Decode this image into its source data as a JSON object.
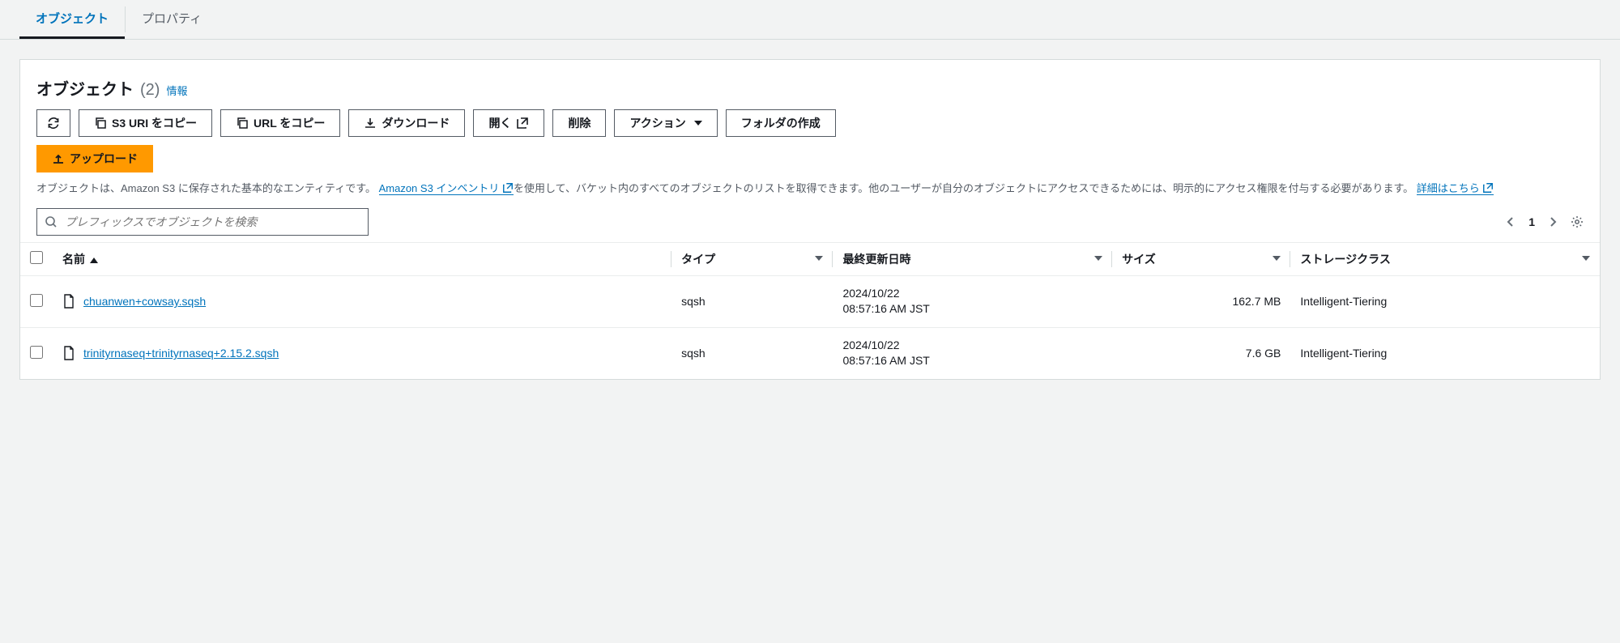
{
  "tabs": {
    "objects": "オブジェクト",
    "properties": "プロパティ"
  },
  "header": {
    "title": "オブジェクト",
    "count": "(2)",
    "info": "情報"
  },
  "toolbar": {
    "copy_s3_uri": "S3 URI をコピー",
    "copy_url": "URL をコピー",
    "download": "ダウンロード",
    "open": "開く",
    "delete": "削除",
    "actions": "アクション",
    "create_folder": "フォルダの作成",
    "upload": "アップロード"
  },
  "desc": {
    "t1": "オブジェクトは、Amazon S3 に保存された基本的なエンティティです。",
    "link1": "Amazon S3 インベントリ",
    "t2": "を使用して、バケット内のすべてのオブジェクトのリストを取得できます。他のユーザーが自分のオブジェクトにアクセスできるためには、明示的にアクセス権限を付与する必要があります。",
    "link2": "詳細はこちら"
  },
  "search": {
    "placeholder": "プレフィックスでオブジェクトを検索"
  },
  "pager": {
    "page": "1"
  },
  "columns": {
    "name": "名前",
    "type": "タイプ",
    "last_modified": "最終更新日時",
    "size": "サイズ",
    "storage_class": "ストレージクラス"
  },
  "rows": [
    {
      "name": "chuanwen+cowsay.sqsh",
      "type": "sqsh",
      "lm1": "2024/10/22",
      "lm2": "08:57:16 AM JST",
      "size": "162.7 MB",
      "sclass": "Intelligent-Tiering"
    },
    {
      "name": "trinityrnaseq+trinityrnaseq+2.15.2.sqsh",
      "type": "sqsh",
      "lm1": "2024/10/22",
      "lm2": "08:57:16 AM JST",
      "size": "7.6 GB",
      "sclass": "Intelligent-Tiering"
    }
  ]
}
